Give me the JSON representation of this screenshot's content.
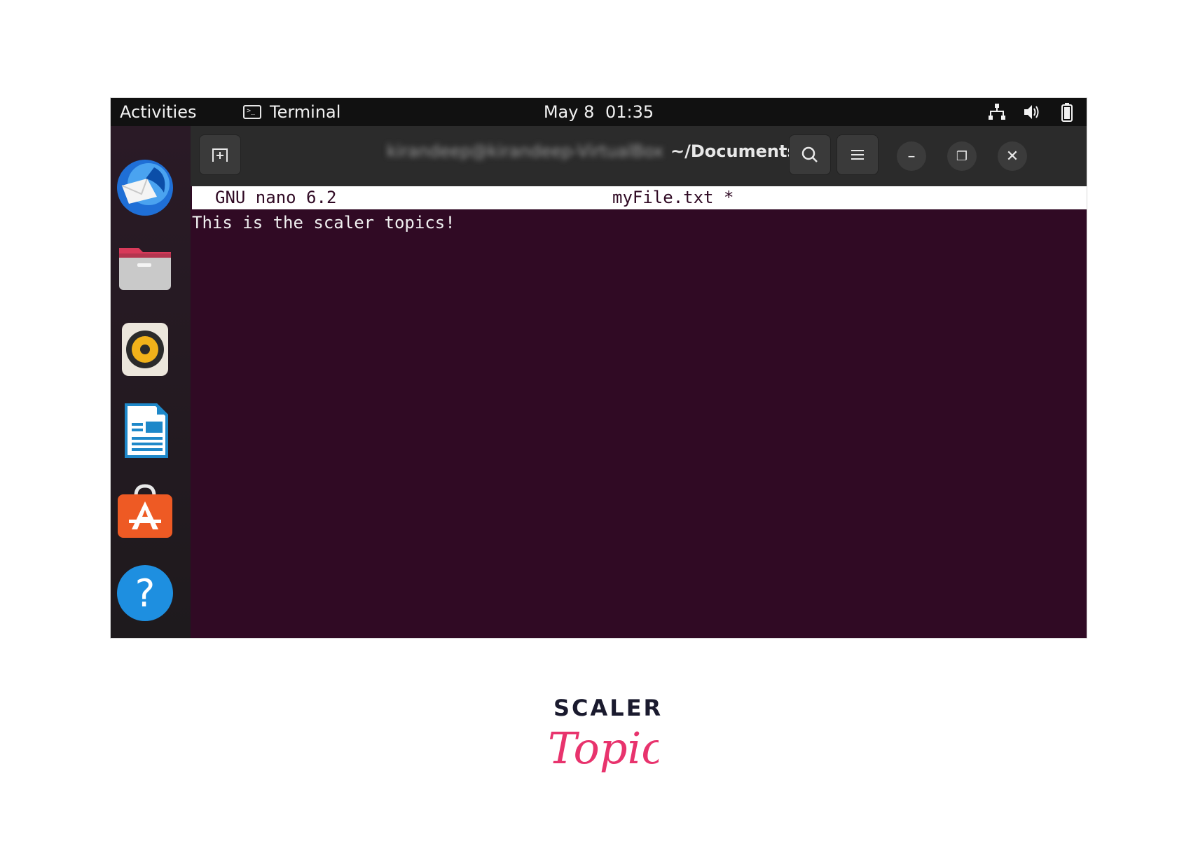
{
  "topbar": {
    "activities": "Activities",
    "app_name": "Terminal",
    "date": "May 8",
    "time": "01:35",
    "tray_icons": [
      "network-icon",
      "volume-icon",
      "battery-icon"
    ]
  },
  "dock": {
    "apps": [
      "thunderbird-icon",
      "files-icon",
      "rhythmbox-icon",
      "writer-icon",
      "software-icon",
      "help-icon"
    ]
  },
  "terminal": {
    "title_user": "kirandeep@kirandeep-VirtualBox",
    "title_path": "~/Documents",
    "new_tab_icon": "new-tab-icon",
    "search_icon": "search-icon",
    "menu_icon": "hamburger-icon",
    "minimize_label": "–",
    "restore_label": "❐",
    "close_label": "✕"
  },
  "nano": {
    "version": "GNU nano 6.2",
    "filename": "myFile.txt *",
    "content": "This is the scaler topics!"
  },
  "logo": {
    "line1": "SCALER",
    "line2": "Topics"
  },
  "colors": {
    "terminal_bg": "#300a24",
    "topbar_bg": "#111111",
    "logo_accent": "#e8336d"
  }
}
